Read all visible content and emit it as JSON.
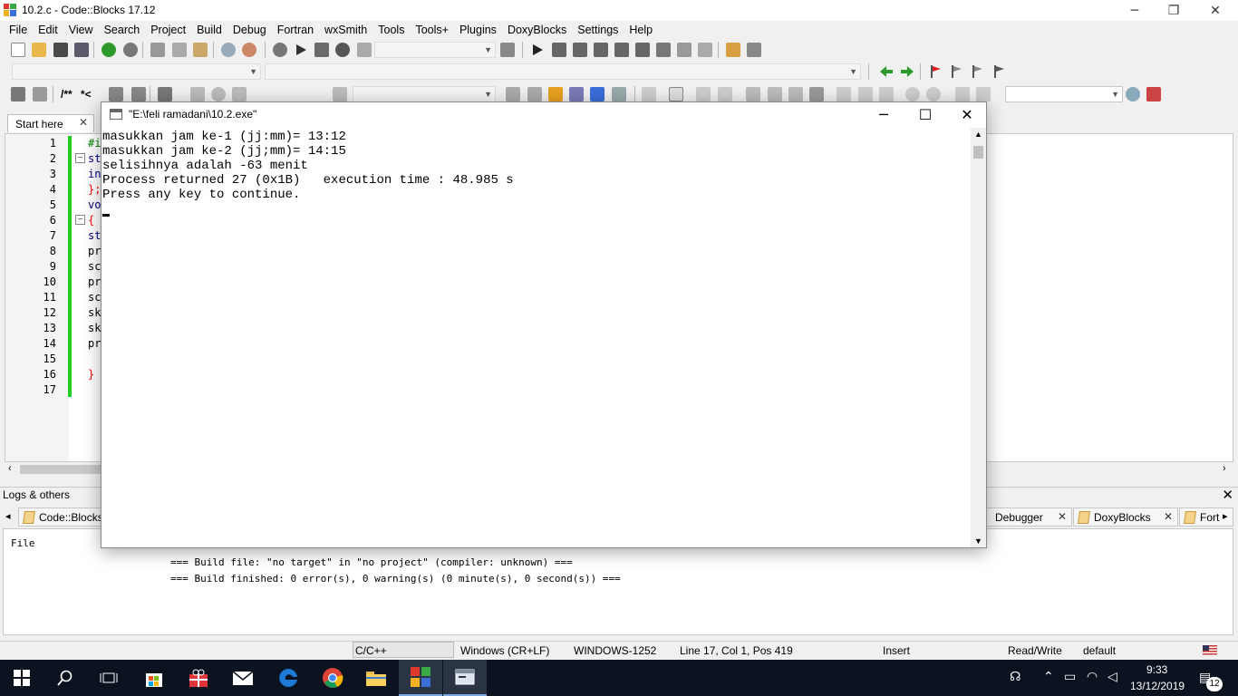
{
  "window": {
    "title": "10.2.c - Code::Blocks 17.12",
    "minimize": "─",
    "restore": "❐",
    "close": "✕"
  },
  "menu": [
    "File",
    "Edit",
    "View",
    "Search",
    "Project",
    "Build",
    "Debug",
    "Fortran",
    "wxSmith",
    "Tools",
    "Tools+",
    "Plugins",
    "DoxyBlocks",
    "Settings",
    "Help"
  ],
  "toolbar": {
    "comment_label": "/**",
    "comment2_label": "*<"
  },
  "editor": {
    "tab_label": "Start here",
    "tab_close": "✕",
    "line_numbers": [
      "1",
      "2",
      "3",
      "4",
      "5",
      "6",
      "7",
      "8",
      "9",
      "10",
      "11",
      "12",
      "13",
      "14",
      "15",
      "16",
      "17"
    ],
    "fragments": [
      {
        "text": "#i",
        "color": "#008000"
      },
      {
        "text": "st",
        "color": "#00008b"
      },
      {
        "text": "in",
        "color": "#00008b"
      },
      {
        "text": "};",
        "color": "#ff0000"
      },
      {
        "text": "vo",
        "color": "#00008b"
      },
      {
        "text": "{",
        "color": "#ff0000"
      },
      {
        "text": "st",
        "color": "#00008b"
      },
      {
        "text": "pr",
        "color": "#000000"
      },
      {
        "text": "sc",
        "color": "#000000"
      },
      {
        "text": "pr",
        "color": "#000000"
      },
      {
        "text": "sc",
        "color": "#000000"
      },
      {
        "text": "sk",
        "color": "#000000"
      },
      {
        "text": "sk",
        "color": "#000000"
      },
      {
        "text": "pr",
        "color": "#000000"
      },
      {
        "text": "",
        "color": "#000000"
      },
      {
        "text": "}",
        "color": "#ff0000"
      },
      {
        "text": "",
        "color": "#000000"
      }
    ]
  },
  "logs": {
    "title": "Logs & others",
    "close": "✕",
    "tabs": [
      {
        "label": "Code::Blocks"
      },
      {
        "label": "Debugger"
      },
      {
        "label": "DoxyBlocks"
      },
      {
        "label": "Fort"
      }
    ],
    "column_header": "File",
    "lines": [
      "=== Build file: \"no target\" in \"no project\" (compiler: unknown) ===",
      "=== Build finished: 0 error(s), 0 warning(s) (0 minute(s), 0 second(s)) ==="
    ]
  },
  "console": {
    "title": "\"E:\\feli ramadani\\10.2.exe\"",
    "lines": [
      "masukkan jam ke-1 (jj:mm)= 13:12",
      "masukkan jam ke-2 (jj;mm)= 14:15",
      "selisihnya adalah -63 menit",
      "Process returned 27 (0x1B)   execution time : 48.985 s",
      "Press any key to continue."
    ]
  },
  "status": {
    "language": "C/C++",
    "eol": "Windows (CR+LF)",
    "encoding": "WINDOWS-1252",
    "position": "Line 17, Col 1, Pos 419",
    "mode": "Insert",
    "access": "Read/Write",
    "profile": "default"
  },
  "taskbar": {
    "time": "9:33",
    "date": "13/12/2019",
    "notifications": "12"
  },
  "colors": {
    "accent_green": "#22cc22",
    "taskbar_bg": "#0b1220",
    "edge_blue": "#1e78d6"
  }
}
